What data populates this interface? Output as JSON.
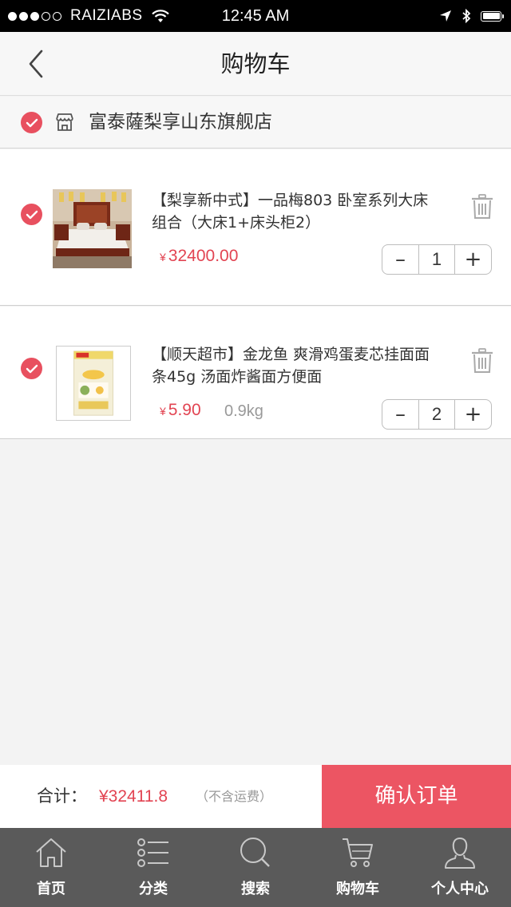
{
  "status_bar": {
    "carrier": "RAIZIABS",
    "time": "12:45 AM",
    "icons": [
      "signal-dots",
      "wifi-icon",
      "location-arrow-icon",
      "bluetooth-icon",
      "battery-icon"
    ]
  },
  "nav": {
    "title": "购物车",
    "back_icon": "chevron-left-icon"
  },
  "store": {
    "name": "富泰薩梨享山东旗舰店",
    "icon": "store-icon",
    "checked": true
  },
  "items": [
    {
      "name": "【梨享新中式】一品梅803 卧室系列大床组合（大床1+床头柜2）",
      "currency": "¥",
      "price": "32400.00",
      "weight": "",
      "quantity": "1",
      "checked": true,
      "image": "bedroom-bed-photo"
    },
    {
      "name": "【顺天超市】金龙鱼 爽滑鸡蛋麦芯挂面面条45g 汤面炸酱面方便面",
      "currency": "¥",
      "price": "5.90",
      "weight": "0.9kg",
      "quantity": "2",
      "checked": true,
      "image": "noodle-package-photo"
    }
  ],
  "stepper": {
    "minus": "–",
    "plus": "+"
  },
  "total": {
    "label": "合计：",
    "value": "¥32411.8",
    "note": "（不含运费）"
  },
  "confirm_button": "确认订单",
  "tabs": [
    {
      "label": "首页",
      "icon": "home-icon"
    },
    {
      "label": "分类",
      "icon": "list-icon"
    },
    {
      "label": "搜索",
      "icon": "search-icon"
    },
    {
      "label": "购物车",
      "icon": "cart-icon"
    },
    {
      "label": "个人中心",
      "icon": "user-icon"
    }
  ],
  "colors": {
    "accent": "#ec5563",
    "price": "#e24452",
    "tabbar": "#5a5a5a"
  }
}
